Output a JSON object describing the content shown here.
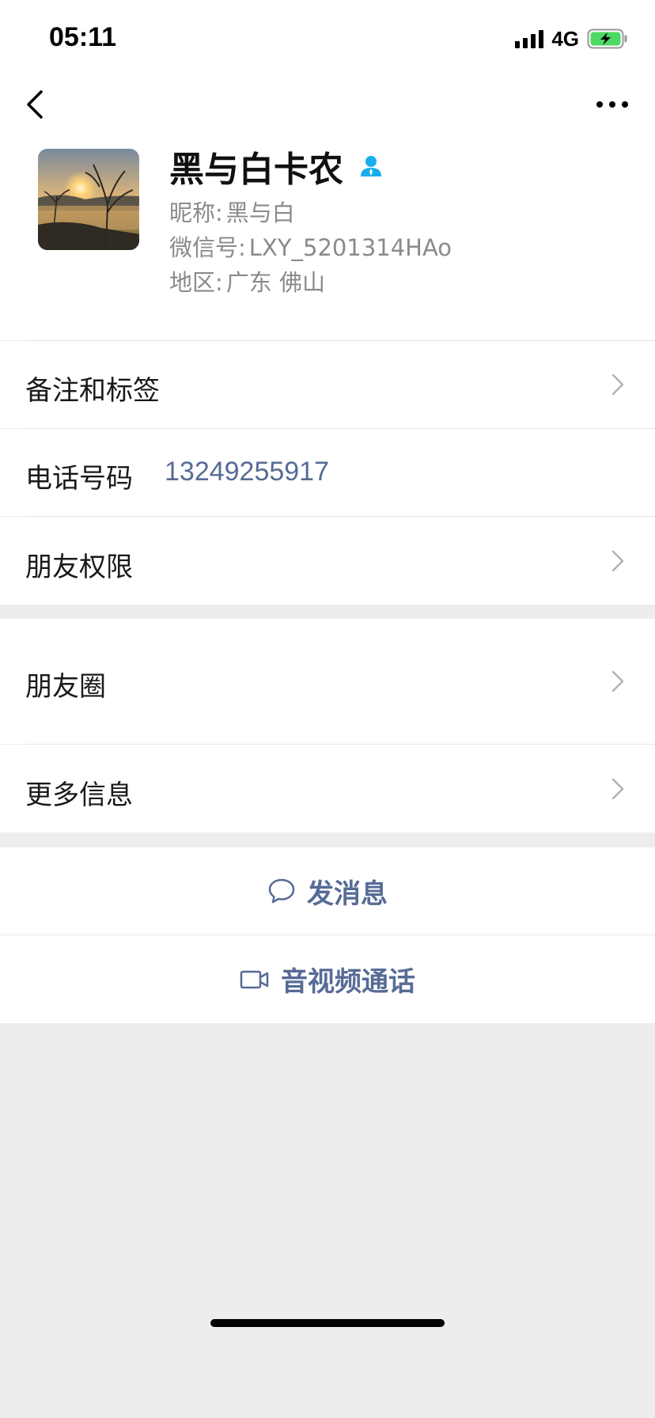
{
  "status_bar": {
    "time": "05:11",
    "network": "4G",
    "battery_state": "charging",
    "battery_color": "#4cd964"
  },
  "nav": {
    "back_icon": "chevron-left-icon",
    "more_icon": "ellipsis-icon"
  },
  "profile": {
    "name": "黑与白卡农",
    "badge_icon": "contact-person-icon",
    "badge_color": "#1aadee",
    "nickname_label": "昵称:",
    "nickname_value": "黑与白",
    "wechat_id_label": "微信号:",
    "wechat_id_value": "LXY_5201314HAo",
    "region_label": "地区:",
    "region_value": "广东 佛山"
  },
  "rows": {
    "remarks_tags": "备注和标签",
    "phone_label": "电话号码",
    "phone_value": "13249255917",
    "friend_permissions": "朋友权限",
    "moments": "朋友圈",
    "more_info": "更多信息"
  },
  "actions": {
    "send_message": "发消息",
    "send_message_icon": "chat-bubble-icon",
    "video_call": "音视频通话",
    "video_call_icon": "video-camera-icon"
  },
  "colors": {
    "link_blue": "#576b95",
    "page_background": "#ededed"
  }
}
